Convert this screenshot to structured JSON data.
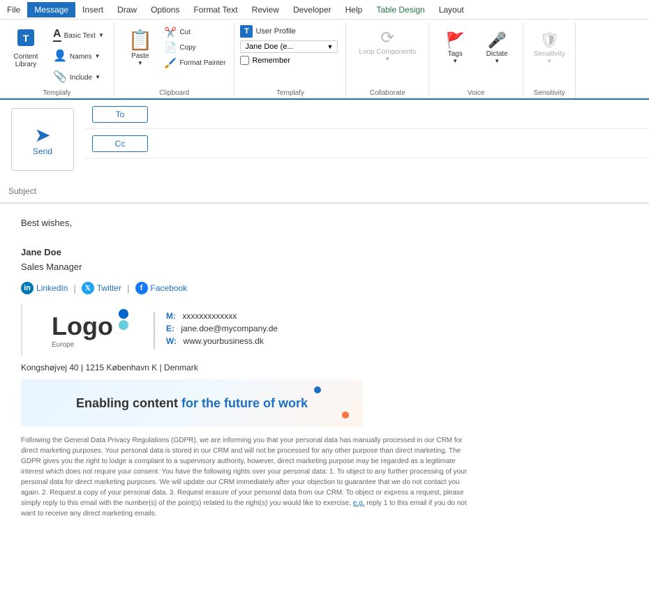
{
  "menubar": {
    "items": [
      "File",
      "Message",
      "Insert",
      "Draw",
      "Options",
      "Format Text",
      "Review",
      "Developer",
      "Help",
      "Table Design",
      "Layout"
    ],
    "active": "Message",
    "special": "Table Design"
  },
  "ribbon": {
    "groups": {
      "templafy1": {
        "label": "Templafy",
        "content_library": "Content Library",
        "basic_text": "Basic Text",
        "names_btn": "Names",
        "include_btn": "Include"
      },
      "clipboard": {
        "label": "Clipboard",
        "paste": "Paste",
        "cut": "Cut",
        "copy": "Copy",
        "format_painter": "Format Painter"
      },
      "templafy2": {
        "label": "Templafy",
        "user_profile_label": "User Profile",
        "dropdown_value": "Jane Doe (e...",
        "dropdown_placeholder": "Jane Doe (e...",
        "remember_label": "Remember"
      },
      "collaborate": {
        "label": "Collaborate",
        "loop_label": "Loop Components"
      },
      "voice": {
        "label": "Voice",
        "tags_label": "Tags",
        "dictate_label": "Dictate"
      },
      "sensitivity": {
        "label": "Sensitivity",
        "sensitivity_label": "Sensitivity"
      }
    }
  },
  "email": {
    "to_label": "To",
    "cc_label": "Cc",
    "to_value": "",
    "cc_value": "",
    "subject_placeholder": "Subject",
    "send_label": "Send",
    "body": {
      "greeting": "Best wishes,",
      "name": "Jane Doe",
      "title": "Sales Manager"
    },
    "social": {
      "linkedin": "LinkedIn",
      "twitter": "Twitter",
      "facebook": "Facebook"
    },
    "contact": {
      "mobile_label": "M:",
      "mobile_value": "xxxxxxxxxxxxx",
      "email_label": "E:",
      "email_value": "jane.doe@mycompany.de",
      "web_label": "W:",
      "web_value": "www.yourbusiness.dk"
    },
    "address": "Kongshøjvej 40 | 1215 København K | Denmark",
    "banner_text_normal": "Enabling content ",
    "banner_text_highlight": "for the future of work",
    "gdpr": "Following the General Data Privacy Regulations (GDPR), we are informing you that your personal data has manually processed in our CRM for direct marketing purposes. Your personal data is stored in our CRM and will not be processed for any other purpose than direct marketing. The GDPR gives you the right to lodge a complaint to a supervisory authority, however, direct marketing purpose may be regarded as a legitimate interest which does not require your consent. You have the following rights over your personal data: 1. To object to any further processing of your personal data for direct marketing purposes. We will update our CRM immediately after your objection to guarantee that we do not contact you again. 2. Request a copy of your personal data. 3. Request erasure of your personal data from our CRM. To object or express a request, please simply reply to this email with the number(s) of the point(s) related to the right(s) you would like to exercise,",
    "gdpr_link": "e.g.",
    "gdpr_end": " reply 1 to this email if you do not want to receive any direct marketing emails."
  }
}
